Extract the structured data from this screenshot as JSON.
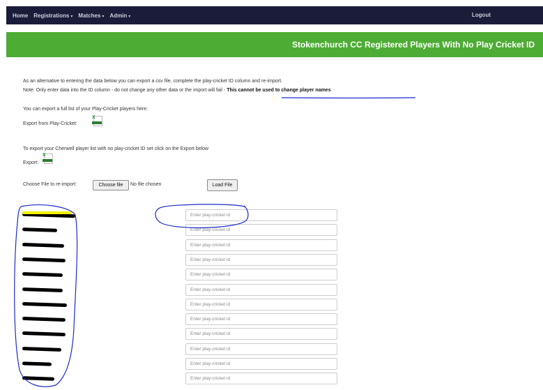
{
  "nav": {
    "items": [
      {
        "label": "Home",
        "caret": false
      },
      {
        "label": "Registrations",
        "caret": true
      },
      {
        "label": "Matches",
        "caret": true
      },
      {
        "label": "Admin",
        "caret": true
      }
    ],
    "logout": "Logout"
  },
  "banner": {
    "title": "Stokenchurch CC Registered Players With No Play Cricket ID"
  },
  "intro": {
    "line1": "As an alternative to entering the data below you can export a csv file, complete the play-cricket ID column and re-import.",
    "line2_prefix": "Note: Only enter data into the ID column - do not change any other data or the import will fail - ",
    "line2_bold": "This cannot be used to change player names"
  },
  "export_pc": {
    "description": "You can export a full list of your Play-Cricket players here:",
    "label": "Export from Play-Cricket:",
    "icon": "excel-icon"
  },
  "export_cherwell": {
    "description": "To export your Cherwell player list with no play-cricket ID set click on the Export below",
    "label": "Export:",
    "icon": "excel-icon"
  },
  "reimport": {
    "label": "Choose File to re-import:",
    "choose_button": "Choose file",
    "no_file_text": "No file chosen",
    "load_button": "Load File"
  },
  "players": {
    "placeholder": "Enter play-cricket id",
    "rows": 12
  },
  "colors": {
    "navbar": "#1b1b3a",
    "banner": "#4dac33",
    "annotation": "#1a2bcc",
    "highlight": "#f2f200"
  }
}
